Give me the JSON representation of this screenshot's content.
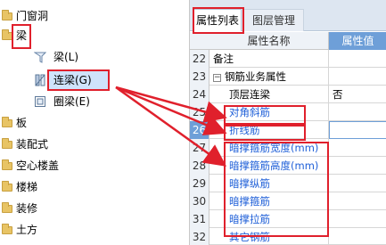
{
  "tree": {
    "items": [
      {
        "label": "门窗洞"
      },
      {
        "label": "梁"
      },
      {
        "label": "梁(L)"
      },
      {
        "label": "连梁(G)"
      },
      {
        "label": "圈梁(E)"
      },
      {
        "label": "板"
      },
      {
        "label": "装配式"
      },
      {
        "label": "空心楼盖"
      },
      {
        "label": "楼梯"
      },
      {
        "label": "装修"
      },
      {
        "label": "土方"
      }
    ]
  },
  "panel": {
    "tabs": [
      {
        "label": "属性列表"
      },
      {
        "label": "图层管理"
      }
    ],
    "header": {
      "name": "属性名称",
      "value": "属性值"
    },
    "rows": [
      {
        "num": "22",
        "name": "备注",
        "value": ""
      },
      {
        "num": "23",
        "name": "钢筋业务属性",
        "value": ""
      },
      {
        "num": "24",
        "name": "顶层连梁",
        "value": "否"
      },
      {
        "num": "25",
        "name": "对角斜筋",
        "value": ""
      },
      {
        "num": "26",
        "name": "折线筋",
        "value": ""
      },
      {
        "num": "27",
        "name": "暗撑箍筋宽度(mm)",
        "value": ""
      },
      {
        "num": "28",
        "name": "暗撑箍筋高度(mm)",
        "value": ""
      },
      {
        "num": "29",
        "name": "暗撑纵筋",
        "value": ""
      },
      {
        "num": "30",
        "name": "暗撑箍筋",
        "value": ""
      },
      {
        "num": "31",
        "name": "暗撑拉筋",
        "value": ""
      },
      {
        "num": "32",
        "name": "其它钢筋",
        "value": ""
      }
    ]
  },
  "colors": {
    "annotation": "#e0202c",
    "link_text": "#2060d8",
    "value_header": "#6e9fd8"
  }
}
